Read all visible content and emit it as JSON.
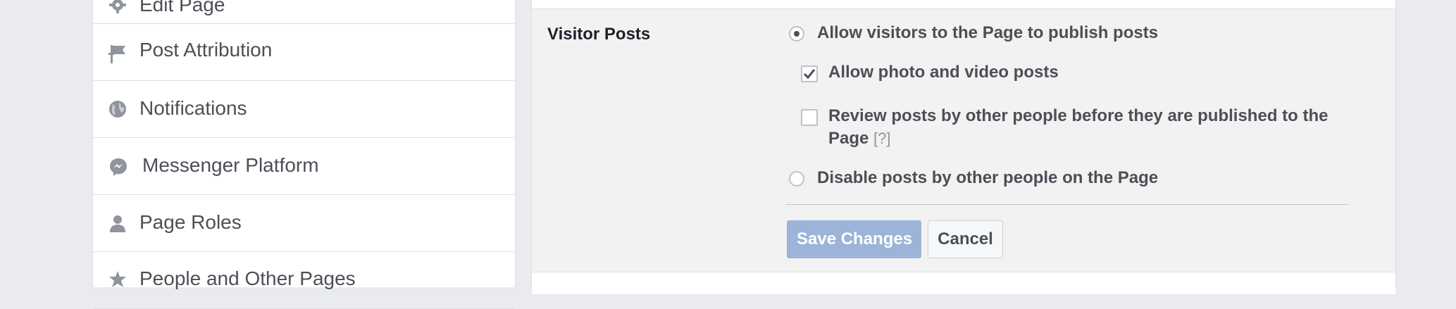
{
  "sidebar": {
    "items": [
      {
        "label": "Edit Page",
        "icon": "gear-icon"
      },
      {
        "label": "Post Attribution",
        "icon": "flag-icon"
      },
      {
        "label": "Notifications",
        "icon": "globe-icon"
      },
      {
        "label": "Messenger Platform",
        "icon": "messenger-icon"
      },
      {
        "label": "Page Roles",
        "icon": "person-icon"
      },
      {
        "label": "People and Other Pages",
        "icon": "star-icon"
      }
    ]
  },
  "settings": {
    "section_title": "Visitor Posts",
    "options": {
      "allow_visitors": "Allow visitors to the Page to publish posts",
      "allow_photo_video": "Allow photo and video posts",
      "review_line1": "Review posts by other people before they are published to the",
      "review_line2": "Page",
      "help_marker": "[?]",
      "disable_posts": "Disable posts by other people on the Page"
    },
    "state": {
      "allow_visitors_selected": true,
      "allow_photo_video_checked": true,
      "review_checked": false,
      "disable_selected": false
    },
    "buttons": {
      "save": "Save Changes",
      "cancel": "Cancel"
    }
  },
  "colors": {
    "page_bg": "#e9ebee",
    "active_row_bg": "#f2f2f2",
    "save_button_bg": "#9cb4d8",
    "text_secondary": "#4b4f56",
    "border": "#dddfe2"
  }
}
